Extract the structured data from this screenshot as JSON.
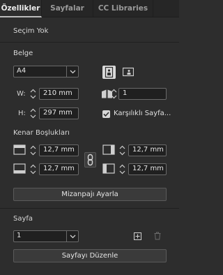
{
  "tabs": [
    {
      "label": "Özellikler",
      "active": true
    },
    {
      "label": "Sayfalar",
      "active": false
    },
    {
      "label": "CC Libraries",
      "active": false
    }
  ],
  "selection_label": "Seçim Yok",
  "document": {
    "section_label": "Belge",
    "preset_value": "A4",
    "width_label": "W:",
    "width_value": "210 mm",
    "height_label": "H:",
    "height_value": "297 mm",
    "pages_value": "1",
    "facing_pages_label": "Karşılıklı Sayfa...",
    "facing_pages_checked": true,
    "orientation": "portrait"
  },
  "margins": {
    "section_label": "Kenar Boşlukları",
    "top_value": "12,7 mm",
    "bottom_value": "12,7 mm",
    "left_value": "12,7 mm",
    "right_value": "12,7 mm",
    "linked": true
  },
  "layout_button_label": "Mizanpajı Ayarla",
  "page": {
    "section_label": "Sayfa",
    "page_value": "1",
    "edit_button_label": "Sayfayı Düzenle"
  },
  "colors": {
    "panel_bg": "#2d2d2d",
    "field_bg": "#202020",
    "accent_text": "#e6e6e6"
  }
}
